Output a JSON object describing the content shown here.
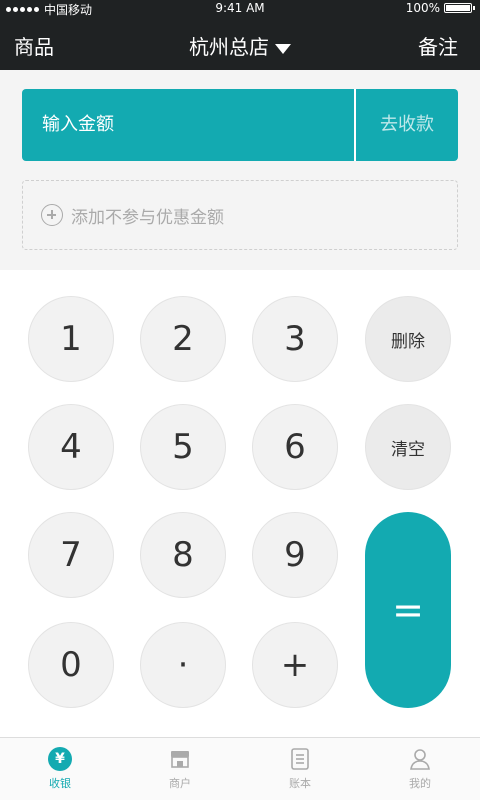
{
  "status_bar": {
    "carrier": "中国移动",
    "time": "9:41 AM",
    "battery": "100%"
  },
  "nav": {
    "left": "商品",
    "title": "杭州总店",
    "right": "备注"
  },
  "amount": {
    "placeholder": "输入金额",
    "collect_label": "去收款"
  },
  "discount": {
    "label": "添加不参与优惠金额"
  },
  "keypad": {
    "k1": "1",
    "k2": "2",
    "k3": "3",
    "delete": "删除",
    "k4": "4",
    "k5": "5",
    "k6": "6",
    "clear": "清空",
    "k7": "7",
    "k8": "8",
    "k9": "9",
    "equals": "=",
    "k0": "0",
    "dot": "·",
    "plus": "+"
  },
  "tabs": [
    {
      "label": "收银",
      "icon": "yen-icon",
      "active": true
    },
    {
      "label": "商户",
      "icon": "store-icon",
      "active": false
    },
    {
      "label": "账本",
      "icon": "book-icon",
      "active": false
    },
    {
      "label": "我的",
      "icon": "person-icon",
      "active": false
    }
  ],
  "colors": {
    "accent": "#13aab1",
    "nav_bg": "#1f2223"
  }
}
